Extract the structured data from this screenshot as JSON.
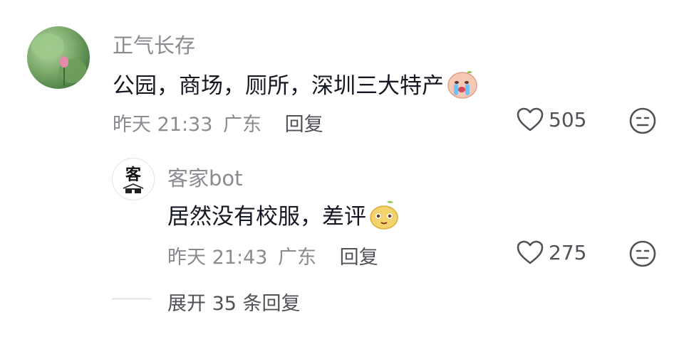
{
  "comment": {
    "username": "正气长存",
    "text": "公园，商场，厕所，深圳三大特产",
    "emoji": "crying-face-emoji",
    "time": "昨天 21:33",
    "location": "广东",
    "reply_label": "回复",
    "like_count": "505"
  },
  "reply": {
    "avatar_char": "客",
    "username": "客家bot",
    "text": "居然没有校服，差评",
    "emoji": "pear-face-emoji",
    "time": "昨天 21:43",
    "location": "广东",
    "reply_label": "回复",
    "like_count": "275"
  },
  "expand_label": "展开 35 条回复",
  "icons": {
    "like": "heart-icon",
    "dislike": "meh-face-icon"
  },
  "colors": {
    "secondary_text": "#8a8b91",
    "primary_text": "#161823"
  }
}
